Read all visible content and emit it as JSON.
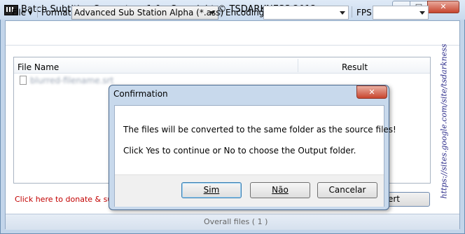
{
  "window": {
    "title": "Batch Subtitles Converter v1.0 - Copyright © TSDARKNESS 2012",
    "min_glyph": "—",
    "max_glyph": "□",
    "close_glyph": "✕"
  },
  "toolbar": {
    "file_menu": "File",
    "menu_arrow": "▾",
    "format_label": "Format",
    "format_value": "Advanced Sub Station Alpha (*.ass)",
    "encoding_label": "Encoding",
    "encoding_value": "",
    "fps_label": "FPS",
    "fps_value": ""
  },
  "list": {
    "columns": [
      "File Name",
      "Result"
    ],
    "rows": [
      {
        "file_name": "blurred-filename.srt",
        "result": ""
      }
    ]
  },
  "side_link": "https://sites.google.com/site/tsdarkness",
  "donate_text": "Click here to donate & suppo",
  "convert_button": "ert",
  "status": "Overall files ( 1 )",
  "dialog": {
    "title": "Confirmation",
    "close_glyph": "✕",
    "message_line1": "The files will be converted to the same folder as the source files!",
    "message_line2": "Click Yes to continue or No to choose the Output folder.",
    "yes_button": "Sim",
    "no_button": "Não",
    "cancel_button": "Cancelar"
  },
  "colors": {
    "frame": "#c3d5ea",
    "donate_text": "#c20000",
    "link_text": "#2b2b8a",
    "close_button": "#c8452e"
  }
}
